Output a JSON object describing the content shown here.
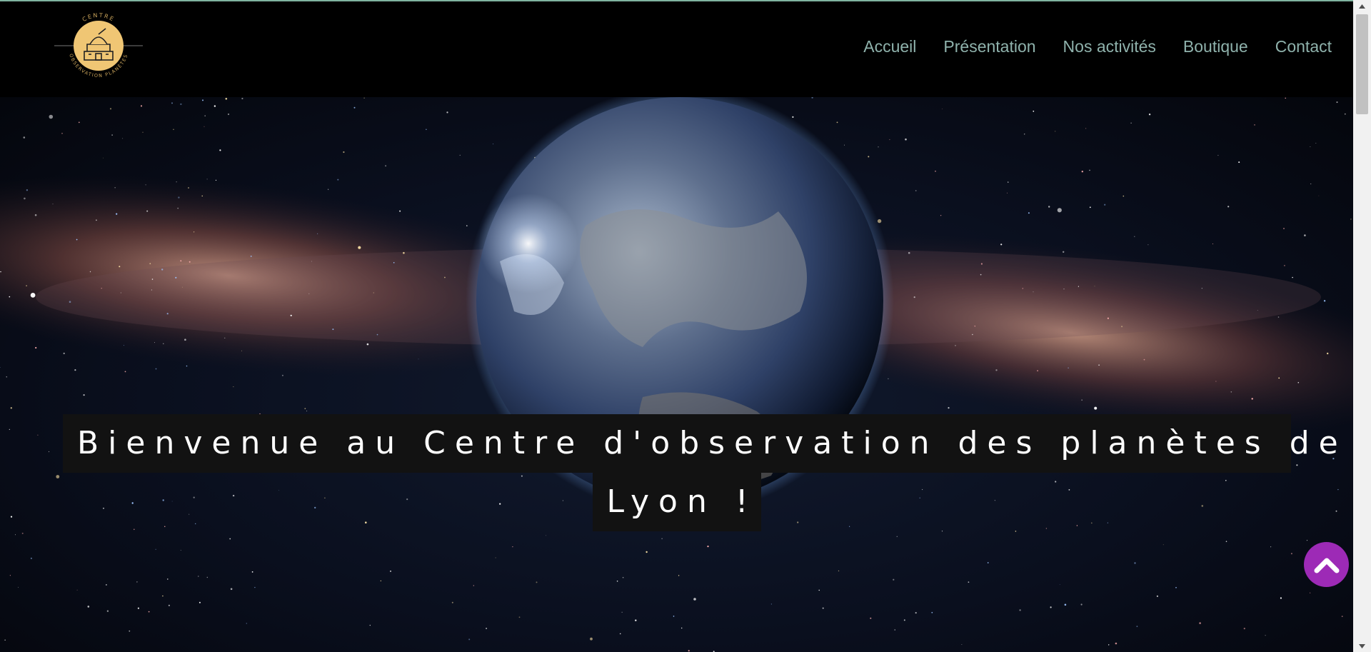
{
  "header": {
    "logo": {
      "top_text": "CENTRE",
      "bottom_text": "OBSERVATION PLANÈTES",
      "badge_color": "#f0c674"
    },
    "nav": [
      {
        "label": "Accueil"
      },
      {
        "label": "Présentation"
      },
      {
        "label": "Nos activités"
      },
      {
        "label": "Boutique"
      },
      {
        "label": "Contact"
      }
    ],
    "nav_color": "#8fb2ac"
  },
  "hero": {
    "title_line1": "Bienvenue au Centre d'observation des planètes de",
    "title_line2": "Lyon !"
  },
  "back_to_top": {
    "icon": "chevron-up-icon",
    "color": "#9d2ab6"
  },
  "scrollbar": {
    "up_icon": "triangle-up-icon",
    "down_icon": "triangle-down-icon"
  }
}
